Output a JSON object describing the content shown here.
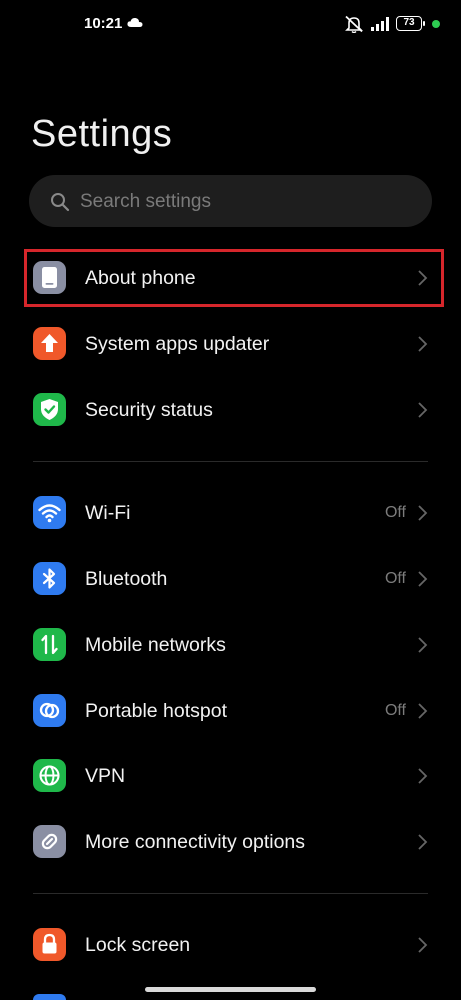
{
  "status_bar": {
    "time": "10:21",
    "battery": "73",
    "icons": [
      "cloud-icon",
      "mute-icon",
      "signal-icon",
      "battery-icon",
      "notification-dot"
    ]
  },
  "page": {
    "title": "Settings"
  },
  "search": {
    "placeholder": "Search settings"
  },
  "items": [
    {
      "label": "About phone",
      "value": "",
      "icon": "phone-icon",
      "color": "#8a8fa3"
    },
    {
      "label": "System apps updater",
      "value": "",
      "icon": "arrow-up-icon",
      "color": "#f0582a"
    },
    {
      "label": "Security status",
      "value": "",
      "icon": "shield-check-icon",
      "color": "#1fb84a"
    },
    {
      "label": "Wi-Fi",
      "value": "Off",
      "icon": "wifi-icon",
      "color": "#2f7bf0"
    },
    {
      "label": "Bluetooth",
      "value": "Off",
      "icon": "bluetooth-icon",
      "color": "#2f7bf0"
    },
    {
      "label": "Mobile networks",
      "value": "",
      "icon": "mobile-data-icon",
      "color": "#1fb84a"
    },
    {
      "label": "Portable hotspot",
      "value": "Off",
      "icon": "hotspot-icon",
      "color": "#2f7bf0"
    },
    {
      "label": "VPN",
      "value": "",
      "icon": "globe-icon",
      "color": "#1fb84a"
    },
    {
      "label": "More connectivity options",
      "value": "",
      "icon": "link-icon",
      "color": "#8a8fa3"
    },
    {
      "label": "Lock screen",
      "value": "",
      "icon": "lock-icon",
      "color": "#f0582a"
    }
  ],
  "colors": {
    "highlight": "#d6262b",
    "background": "#000000"
  }
}
